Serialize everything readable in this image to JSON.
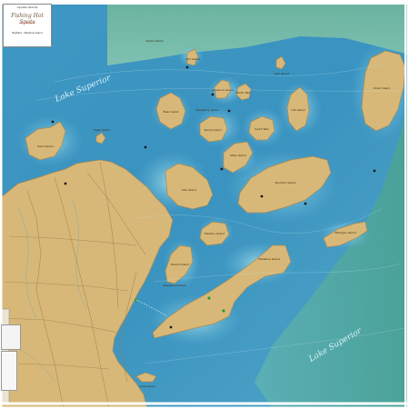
{
  "map": {
    "water_labels": {
      "lake_superior_nw": "Lake Superior",
      "lake_superior_se": "Lake Superior"
    },
    "island_labels": {
      "madeline": "Madeline Island",
      "stockton": "Stockton Island",
      "outer": "Outer Island",
      "sand": "Sand Island",
      "oak": "Oak Island",
      "bear": "Bear Island",
      "rocky": "Rocky Island",
      "otter": "Otter Island",
      "cat": "Cat Island",
      "ironwood": "Ironwood Island",
      "hermit": "Hermit Island",
      "basswood": "Basswood Island",
      "michigan": "Michigan Island",
      "raspberry": "Raspberry Island",
      "manitou": "Manitou Island",
      "south_twin": "South Twin",
      "north_twin": "North Twin",
      "devils": "Devils Island",
      "york": "York Island",
      "eagle": "Eagle Island",
      "gull": "Gull Island",
      "long": "Long Island"
    },
    "title_block": {
      "line1": "Apostle Islands",
      "brand": "Fishing Hot Spots",
      "line3": "Lake Superior",
      "line4": "Bayfield · Madeline Island"
    },
    "colors": {
      "deep_water": "#2e86b5",
      "shallow_water": "#7ec8dc",
      "green_water": "#6fb8a2",
      "land": "#d8b878",
      "land_edge": "#a88a55",
      "road": "#9a7a4a",
      "frame": "#ffffff"
    }
  }
}
